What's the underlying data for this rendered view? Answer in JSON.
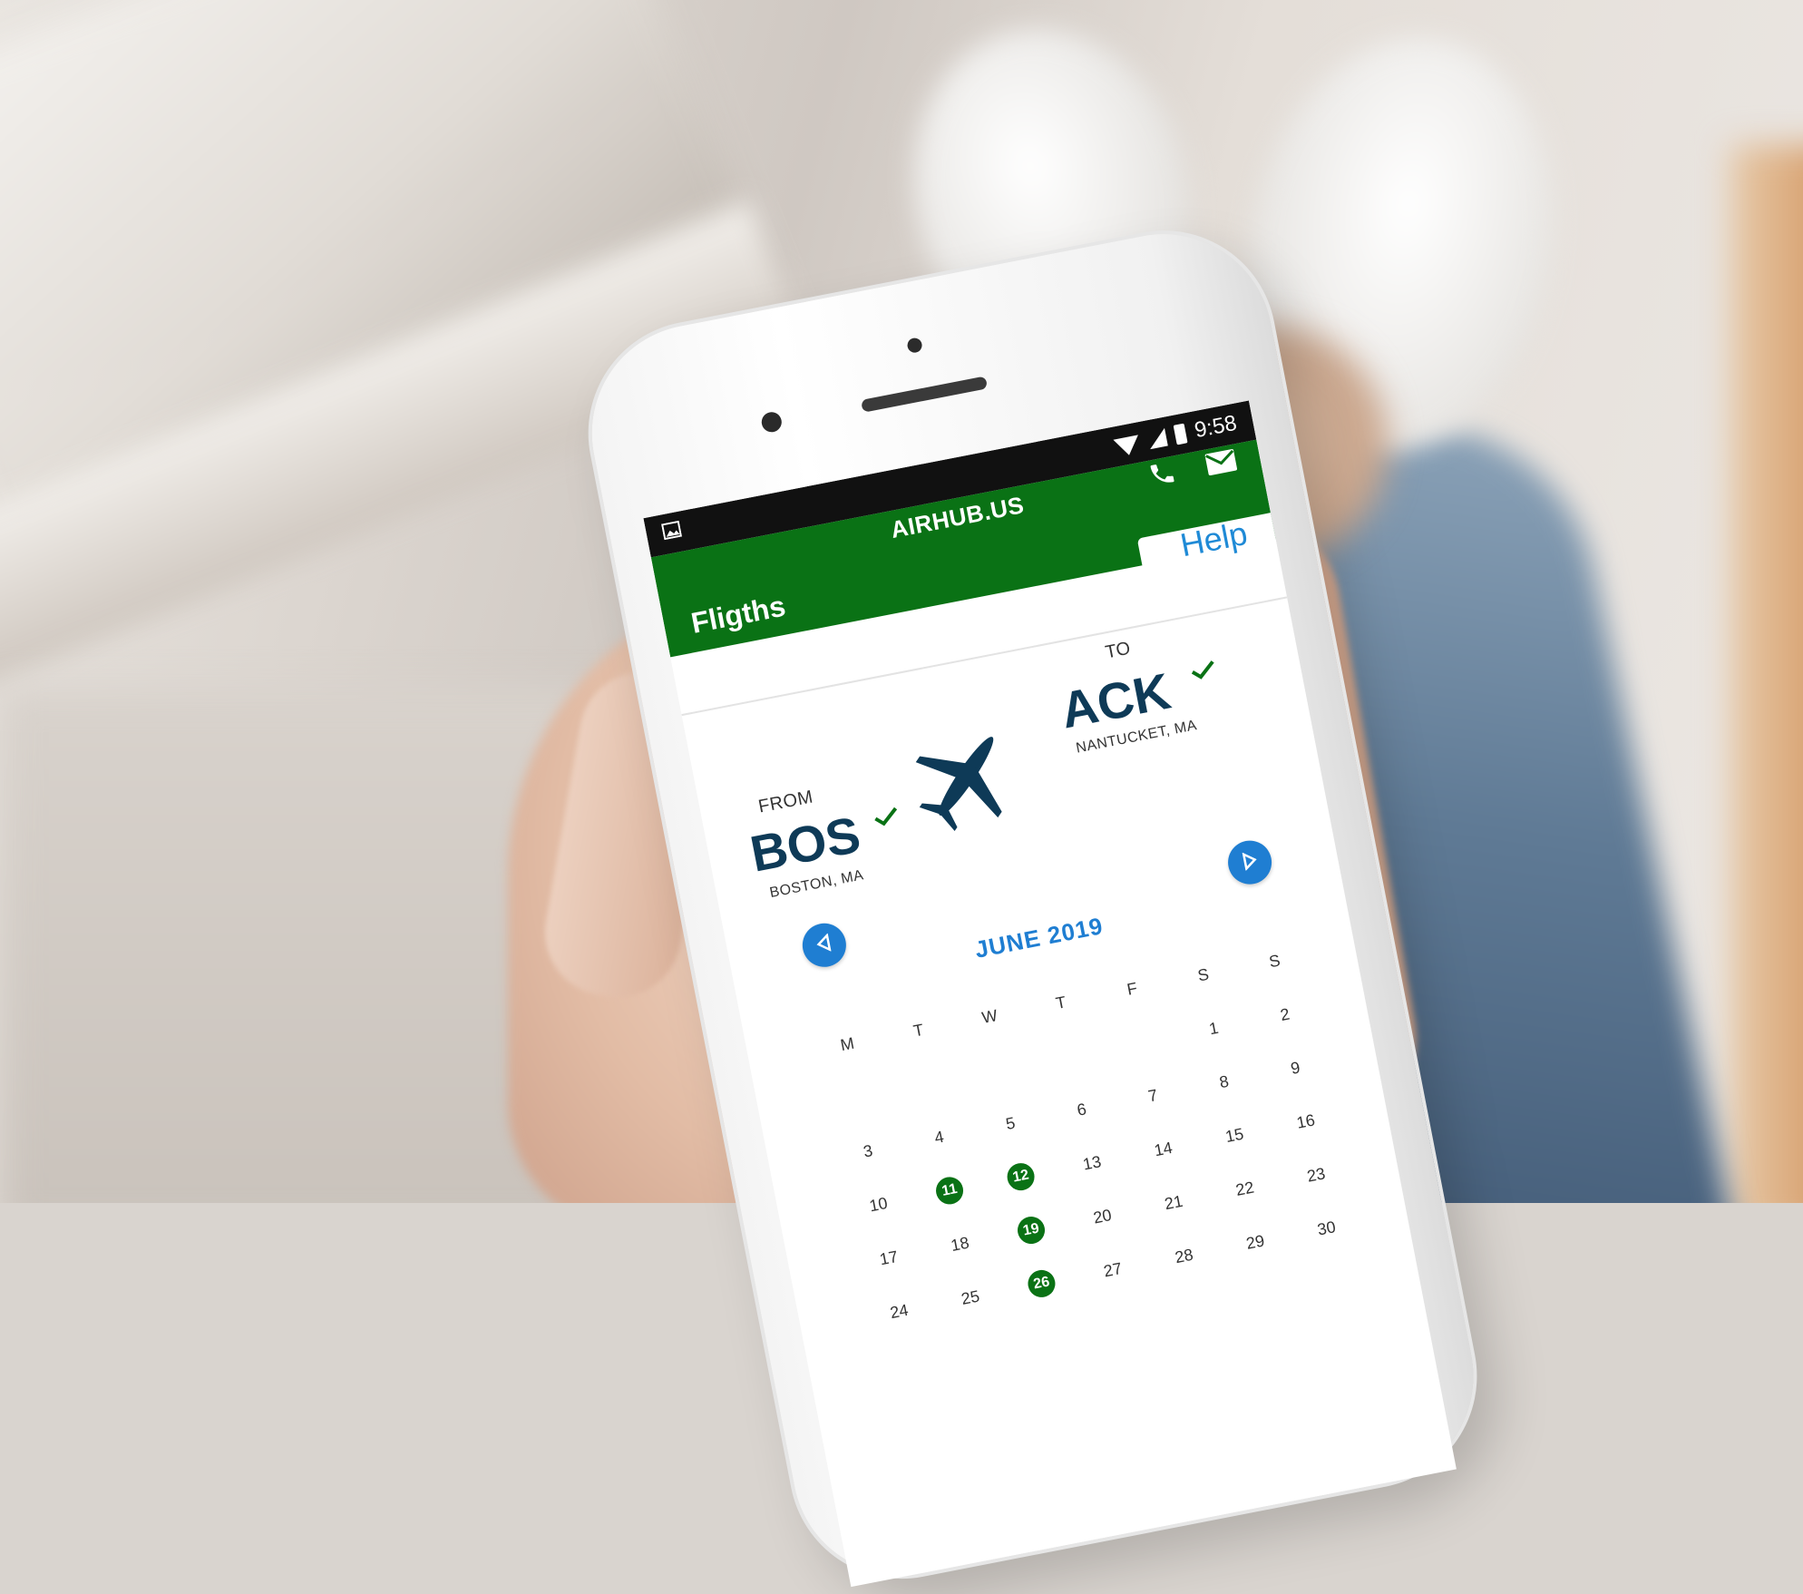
{
  "status_bar": {
    "time": "9:58"
  },
  "app_bar": {
    "brand": "AIRHUB.US",
    "title": "Fligths",
    "help": "Help"
  },
  "route": {
    "from": {
      "label": "FROM",
      "code": "BOS",
      "city": "BOSTON, MA"
    },
    "to": {
      "label": "TO",
      "code": "ACK",
      "city": "NANTUCKET, MA"
    }
  },
  "calendar": {
    "month": "JUNE 2019",
    "weekdays": [
      "M",
      "T",
      "W",
      "T",
      "F",
      "S",
      "S"
    ],
    "leading_blank_days": 5,
    "days": [
      "1",
      "2",
      "3",
      "4",
      "5",
      "6",
      "7",
      "8",
      "9",
      "10",
      "11",
      "12",
      "13",
      "14",
      "15",
      "16",
      "17",
      "18",
      "19",
      "20",
      "21",
      "22",
      "23",
      "24",
      "25",
      "26",
      "27",
      "28",
      "29",
      "30"
    ],
    "available_days": [
      "11",
      "12",
      "19",
      "26"
    ]
  },
  "colors": {
    "app_bar": "#0a7215",
    "accent_blue": "#1f7ed2",
    "code_text": "#0e3a57",
    "available_day": "#0a7215"
  },
  "icons": {
    "status": [
      "image-icon",
      "wifi-icon",
      "signal-icon",
      "battery-icon"
    ],
    "app_bar": [
      "phone-icon",
      "mail-icon"
    ],
    "route": "airplane-icon",
    "calendar_nav": [
      "chevron-left-icon",
      "chevron-right-icon"
    ]
  }
}
